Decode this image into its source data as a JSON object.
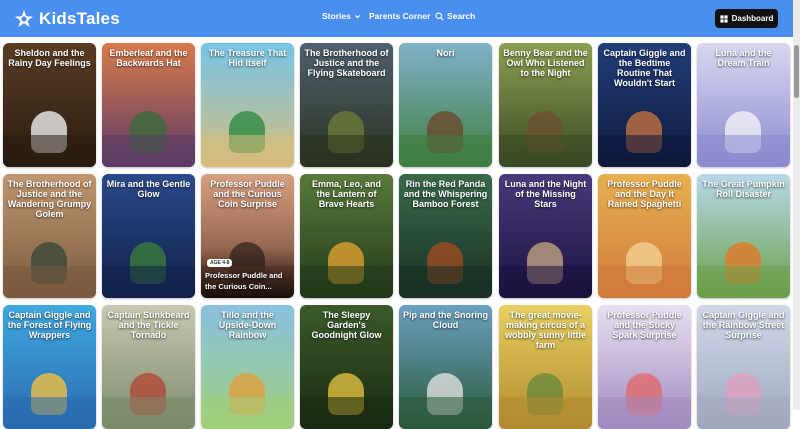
{
  "header": {
    "brand": "KidsTales",
    "nav": [
      {
        "label": "Stories"
      },
      {
        "label": "Parents Corner"
      },
      {
        "label": "Search"
      }
    ],
    "dashboard_label": "Dashboard"
  },
  "stories": [
    {
      "title": "Sheldon and the Rainy Day Feelings",
      "colors": [
        "#5a3c22",
        "#2a1b10",
        "#eeeeee"
      ]
    },
    {
      "title": "Emberleaf and the Backwards Hat",
      "colors": [
        "#d97a4a",
        "#5b3b66",
        "#3a6b3a"
      ]
    },
    {
      "title": "The Treasure That Hid Itself",
      "colors": [
        "#74c6e8",
        "#d7bc7c",
        "#2f8a45"
      ]
    },
    {
      "title": "The Brotherhood of Justice and the Flying Skateboard",
      "colors": [
        "#4f5f6e",
        "#2a3320",
        "#6b7a3a"
      ]
    },
    {
      "title": "Nori",
      "colors": [
        "#7fb2c8",
        "#3f7e40",
        "#6d4a30"
      ]
    },
    {
      "title": "Benny Bear and the Owl Who Listened to the Night",
      "colors": [
        "#8aa050",
        "#3a4a25",
        "#6c5030"
      ]
    },
    {
      "title": "Captain Giggle and the Bedtime Routine That Wouldn't Start",
      "colors": [
        "#213d7a",
        "#0f1a3d",
        "#c07040"
      ]
    },
    {
      "title": "Luna and the Dream Train",
      "colors": [
        "#d8d8f0",
        "#8a8ad0",
        "#f0f0f8"
      ]
    },
    {
      "title": "The Brotherhood of Justice and the Wandering Grumpy Golem",
      "colors": [
        "#c09770",
        "#7a5a3e",
        "#3a4a3a"
      ]
    },
    {
      "title": "Mira and the Gentle Glow",
      "colors": [
        "#2a4a8a",
        "#11204a",
        "#3a7a3a"
      ]
    },
    {
      "title": "Professor Puddle and the Curious Coin Surprise",
      "colors": [
        "#d7a080",
        "#6a4030",
        "#3a2a20"
      ]
    },
    {
      "title": "Emma, Leo, and the Lantern of Brave Hearts",
      "colors": [
        "#5a7a3a",
        "#203a1a",
        "#e0a030"
      ]
    },
    {
      "title": "Rin the Red Panda and the Whispering Bamboo Forest",
      "colors": [
        "#3a6a4a",
        "#173024",
        "#a04a20"
      ]
    },
    {
      "title": "Luna and the Night of the Missing Stars",
      "colors": [
        "#4a3a7a",
        "#1a1240",
        "#c0a080"
      ]
    },
    {
      "title": "Professor Puddle and the Day It Rained Spaghetti",
      "colors": [
        "#e8b050",
        "#d07a3a",
        "#f0d090"
      ]
    },
    {
      "title": "The Great Pumpkin Roll Disaster",
      "colors": [
        "#b8d8e8",
        "#6aa04a",
        "#e07a2a"
      ]
    },
    {
      "title": "Captain Giggle and the Forest of Flying Wrappers",
      "colors": [
        "#40a8e0",
        "#2a6ab0",
        "#f0c040"
      ]
    },
    {
      "title": "Captain Stinkbeard and the Tickle Tornado",
      "colors": [
        "#c8c8b0",
        "#7a8a6a",
        "#b04a3a"
      ]
    },
    {
      "title": "Tillo and the Upside-Down Rainbow",
      "colors": [
        "#8ac0e0",
        "#a0d07a",
        "#e0a040"
      ]
    },
    {
      "title": "The Sleepy Garden's Goodnight Glow",
      "colors": [
        "#3a5a2a",
        "#1a2a10",
        "#e0c040"
      ]
    },
    {
      "title": "Pip and the Snoring Cloud",
      "colors": [
        "#6aa0c0",
        "#2a5a3a",
        "#e0e0e0"
      ]
    },
    {
      "title": "The great movie-making circus of a wobbly sunny little farm",
      "colors": [
        "#e8d060",
        "#b08a30",
        "#6a8a3a"
      ]
    },
    {
      "title": "Professor Puddle and the Sticky Spark Surprise",
      "colors": [
        "#e8e0f0",
        "#a08ac0",
        "#e06a6a"
      ]
    },
    {
      "title": "Captain Giggle and the Rainbow Street Surprise",
      "colors": [
        "#d0d8e8",
        "#a0a8c0",
        "#e0a0c0"
      ]
    }
  ],
  "hovered": {
    "age_badge": "AGE 4-8",
    "caption": "Professor Puddle and the Curious Coin..."
  }
}
